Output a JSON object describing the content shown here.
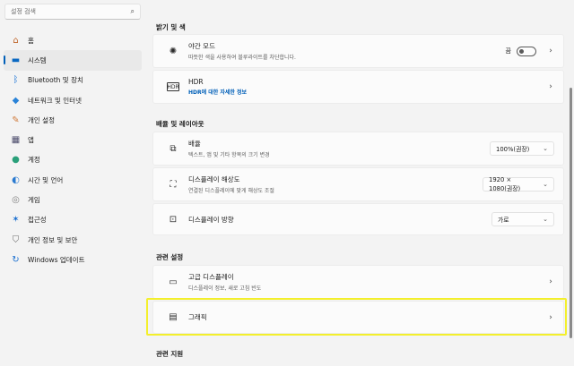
{
  "search": {
    "placeholder": "설정 검색",
    "icon": "search-icon"
  },
  "sidebar": {
    "items": [
      {
        "label": "홈",
        "icon": "home-icon",
        "glyph": "⌂",
        "color": "#c0672c"
      },
      {
        "label": "시스템",
        "icon": "system-icon",
        "glyph": "▬",
        "color": "#0a68c2",
        "active": true
      },
      {
        "label": "Bluetooth 및 장치",
        "icon": "bluetooth-icon",
        "glyph": "ᛒ",
        "color": "#1b74d6"
      },
      {
        "label": "네트워크 및 인터넷",
        "icon": "wifi-icon",
        "glyph": "◆",
        "color": "#2a83d8"
      },
      {
        "label": "개인 설정",
        "icon": "brush-icon",
        "glyph": "✎",
        "color": "#d07a3a"
      },
      {
        "label": "앱",
        "icon": "apps-icon",
        "glyph": "▦",
        "color": "#4a4a6a"
      },
      {
        "label": "계정",
        "icon": "account-icon",
        "glyph": "●",
        "color": "#2aa07a"
      },
      {
        "label": "시간 및 언어",
        "icon": "globe-icon",
        "glyph": "◐",
        "color": "#2a7ad0"
      },
      {
        "label": "게임",
        "icon": "gamepad-icon",
        "glyph": "◎",
        "color": "#808080"
      },
      {
        "label": "접근성",
        "icon": "accessibility-icon",
        "glyph": "✶",
        "color": "#1a6fd0"
      },
      {
        "label": "개인 정보 및 보안",
        "icon": "shield-icon",
        "glyph": "⛉",
        "color": "#6a6a6a"
      },
      {
        "label": "Windows 업데이트",
        "icon": "update-icon",
        "glyph": "↻",
        "color": "#1a6fd0"
      }
    ]
  },
  "brightness": {
    "section_title": "밝기 및 색",
    "night_mode": {
      "title": "야간 모드",
      "sub": "따뜻한 색을 사용하여 블루라이트를 차단합니다.",
      "toggle_label": "끔",
      "icon": "sun-icon"
    },
    "hdr": {
      "title": "HDR",
      "sub": "HDR에 대한 자세한 정보",
      "icon": "hdr-icon"
    }
  },
  "layout": {
    "section_title": "배율 및 레이아웃",
    "scale": {
      "title": "배율",
      "sub": "텍스트, 앱 및 기타 항목의 크기 변경",
      "value": "100%(권장)",
      "icon": "scale-icon"
    },
    "resolution": {
      "title": "디스플레이 해상도",
      "sub": "연결된 디스플레이에 맞게 해상도 조절",
      "value": "1920 × 1080(권장)",
      "icon": "resolution-icon"
    },
    "orientation": {
      "title": "디스플레이 방향",
      "value": "가로",
      "icon": "orientation-icon"
    }
  },
  "related": {
    "section_title": "관련 설정",
    "advanced": {
      "title": "고급 디스플레이",
      "sub": "디스플레이 정보, 새로 고침 빈도",
      "icon": "monitor-icon"
    },
    "graphics": {
      "title": "그래픽",
      "icon": "graphics-icon"
    }
  },
  "support": {
    "section_title": "관련 지원"
  },
  "colors": {
    "accent": "#005fb8",
    "highlight": "#f3ef2c"
  }
}
